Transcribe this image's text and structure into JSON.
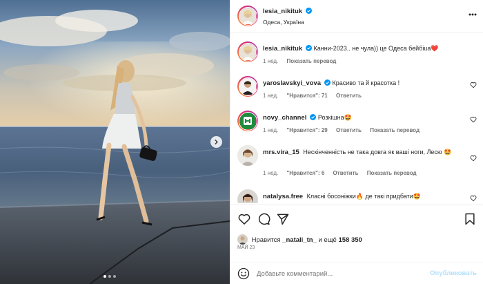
{
  "post": {
    "author": "lesia_nikituk",
    "location": "Одеса, Україна",
    "carousel": {
      "slides": 3,
      "active": 1
    }
  },
  "comments": [
    {
      "username": "lesia_nikituk",
      "verified": true,
      "text": "Канни-2023.. не чула)) це Одеса бейбіuа❤️",
      "time": "1 нед.",
      "likes": "",
      "reply": "",
      "translate": "Показать перевод",
      "has_heart": false
    },
    {
      "username": "yaroslavskyi_vova",
      "verified": true,
      "text": "Красиво та й красотка !",
      "time": "1 нед.",
      "likes": "\"Нравится\": 71",
      "reply": "Ответить",
      "translate": "",
      "has_heart": true
    },
    {
      "username": "novy_channel",
      "verified": true,
      "text": "Розкішна🤩",
      "time": "1 нед.",
      "likes": "\"Нравится\": 29",
      "reply": "Ответить",
      "translate": "Показать перевод",
      "has_heart": true
    },
    {
      "username": "mrs.vira_15",
      "verified": false,
      "text": "Нескінченність не така довга як ваші ноги, Лесю 🤩",
      "time": "1 нед.",
      "likes": "\"Нравится\": 6",
      "reply": "Ответить",
      "translate": "Показать перевод",
      "has_heart": true
    },
    {
      "username": "natalysa.free",
      "verified": false,
      "text": "Класні босоніжки🔥 де такі придбати🤩",
      "time": "",
      "likes": "",
      "reply": "",
      "translate": "",
      "has_heart": true
    }
  ],
  "actions": {
    "icons": [
      "heart-icon",
      "comment-icon",
      "share-icon",
      "bookmark-icon"
    ],
    "likes_prefix": "Нравится",
    "likes_user": "_natali_tn_",
    "likes_and": "и ещё",
    "likes_count": "158 350",
    "date": "МАЙ 23"
  },
  "add_comment": {
    "placeholder": "Добавьте комментарий...",
    "publish_label": "Опубликовать"
  },
  "colors": {
    "verified": "#0095f6",
    "text": "#262626",
    "secondary": "#737373",
    "publish_disabled": "#b2dffc",
    "heart_red": "#ed4956"
  }
}
